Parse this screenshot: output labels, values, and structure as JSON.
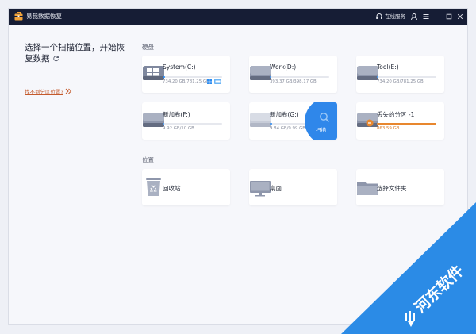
{
  "app": {
    "title": "易我数据恢复",
    "service_label": "在线服务",
    "icon": "toolbox-icon"
  },
  "titlebar_buttons": [
    {
      "name": "account-icon"
    },
    {
      "name": "menu-icon"
    },
    {
      "name": "minimize-icon"
    },
    {
      "name": "maximize-icon"
    },
    {
      "name": "close-icon"
    }
  ],
  "left": {
    "title": "选择一个扫描位置，开始恢复数据",
    "help_link": "找不到分区位置?"
  },
  "sections": {
    "disks": "硬盘",
    "locations": "位置"
  },
  "drives": [
    {
      "name": "System(C:)",
      "size": "734.20 GB/781.25 GB",
      "used_fraction": 0.02,
      "icon": "windows-drive-icon",
      "badges": [
        "windows-icon",
        "drive-badge-icon"
      ]
    },
    {
      "name": "Work(D:)",
      "size": "393.37 GB/398.17 GB",
      "used_fraction": 0.02,
      "icon": "drive-icon"
    },
    {
      "name": "Tool(E:)",
      "size": "734.20 GB/781.25 GB",
      "used_fraction": 0.02,
      "icon": "drive-icon"
    },
    {
      "name": "新加卷(F:)",
      "size": "9.92 GB/10 GB",
      "used_fraction": 0.02,
      "icon": "drive-icon"
    },
    {
      "name": "新加卷(G:)",
      "size": "9.84 GB/9.99 GB",
      "used_fraction": 0.02,
      "icon": "drive-icon",
      "hover_action": "扫描"
    },
    {
      "name": "丢失的分区 -1",
      "size": "863.59 GB",
      "used_fraction": 1.0,
      "icon": "lost-partition-icon",
      "bar_color": "#e8872e"
    }
  ],
  "locations": [
    {
      "name": "回收站",
      "icon": "recycle-bin-icon"
    },
    {
      "name": "桌面",
      "icon": "desktop-icon"
    },
    {
      "name": "选择文件夹",
      "icon": "folder-icon"
    }
  ],
  "watermark": {
    "text": "河东软件",
    "icon": "brand-logo-icon"
  },
  "colors": {
    "titlebar": "#161d35",
    "accent": "#2d8cf0",
    "lost": "#e8872e",
    "watermark": "#2b8be6"
  }
}
